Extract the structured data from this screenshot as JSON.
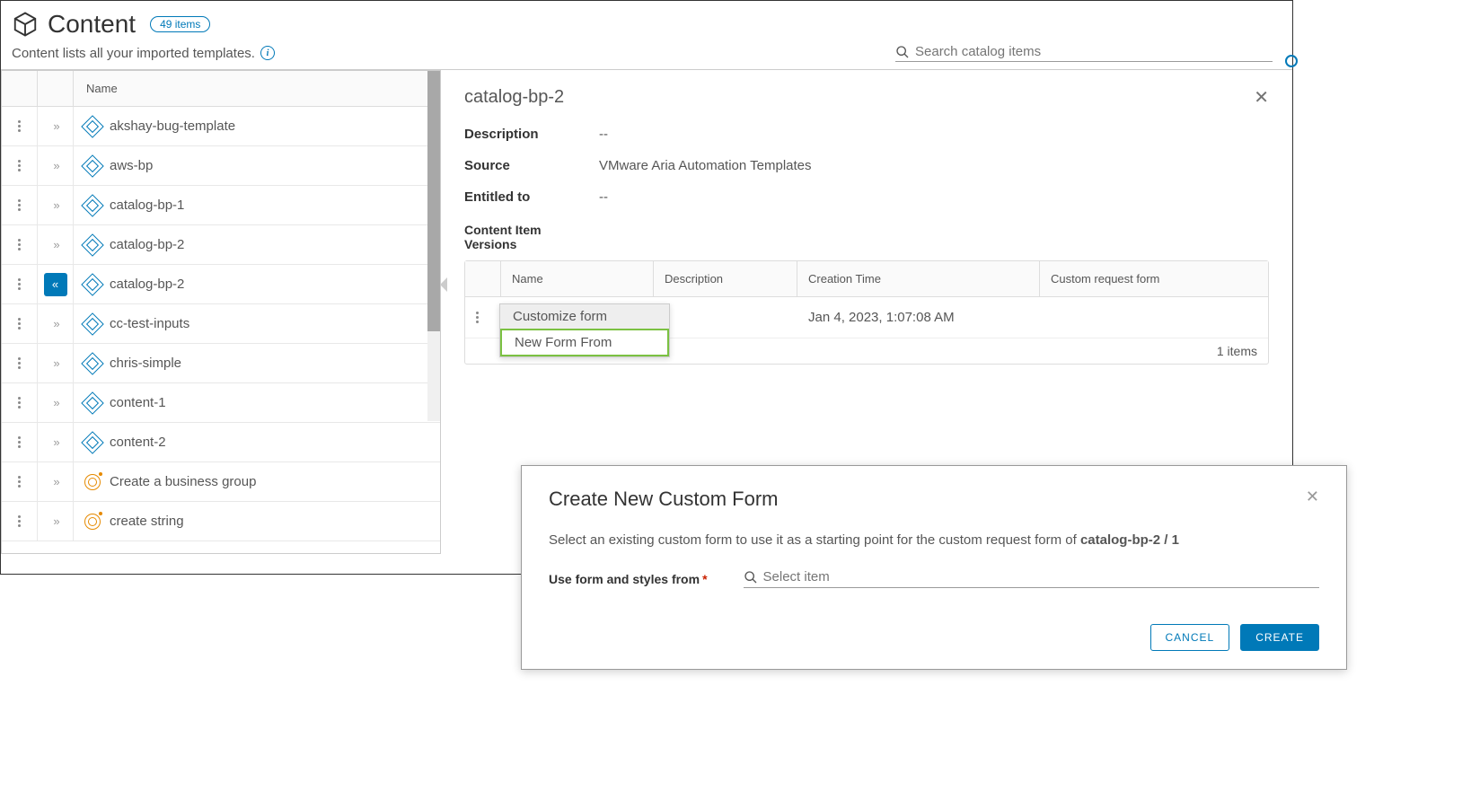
{
  "header": {
    "title": "Content",
    "badge": "49 items",
    "subtitle": "Content lists all your imported templates.",
    "search_placeholder": "Search catalog items"
  },
  "list": {
    "column_header": "Name",
    "rows": [
      {
        "name": "akshay-bug-template",
        "icon": "bp",
        "expanded": false,
        "selected": false
      },
      {
        "name": "aws-bp",
        "icon": "bp",
        "expanded": false,
        "selected": false
      },
      {
        "name": "catalog-bp-1",
        "icon": "bp",
        "expanded": false,
        "selected": false
      },
      {
        "name": "catalog-bp-2",
        "icon": "bp",
        "expanded": false,
        "selected": false
      },
      {
        "name": "catalog-bp-2",
        "icon": "bp",
        "expanded": true,
        "selected": true
      },
      {
        "name": "cc-test-inputs",
        "icon": "bp",
        "expanded": false,
        "selected": false
      },
      {
        "name": "chris-simple",
        "icon": "bp",
        "expanded": false,
        "selected": false
      },
      {
        "name": "content-1",
        "icon": "bp",
        "expanded": false,
        "selected": false
      },
      {
        "name": "content-2",
        "icon": "bp",
        "expanded": false,
        "selected": false
      },
      {
        "name": "Create a business group",
        "icon": "target",
        "expanded": false,
        "selected": false
      },
      {
        "name": "create string",
        "icon": "target",
        "expanded": false,
        "selected": false
      }
    ]
  },
  "detail": {
    "title": "catalog-bp-2",
    "labels": {
      "description": "Description",
      "source": "Source",
      "entitled": "Entitled to",
      "versions": "Content Item Versions"
    },
    "description": "--",
    "source": "VMware Aria Automation Templates",
    "entitled": "--",
    "vtable": {
      "cols": {
        "name": "Name",
        "desc": "Description",
        "time": "Creation Time",
        "form": "Custom request form"
      },
      "rows": [
        {
          "time": "Jan 4, 2023, 1:07:08 AM"
        }
      ],
      "footer": "1 items"
    },
    "ctx_menu": {
      "item1": "Customize form",
      "item2": "New Form From"
    }
  },
  "modal": {
    "title": "Create New Custom Form",
    "text_prefix": "Select an existing custom form to use it as a starting point for the custom request form of ",
    "text_bold": "catalog-bp-2 / 1",
    "field_label": "Use form and styles from",
    "field_placeholder": "Select item",
    "cancel": "CANCEL",
    "create": "CREATE"
  }
}
